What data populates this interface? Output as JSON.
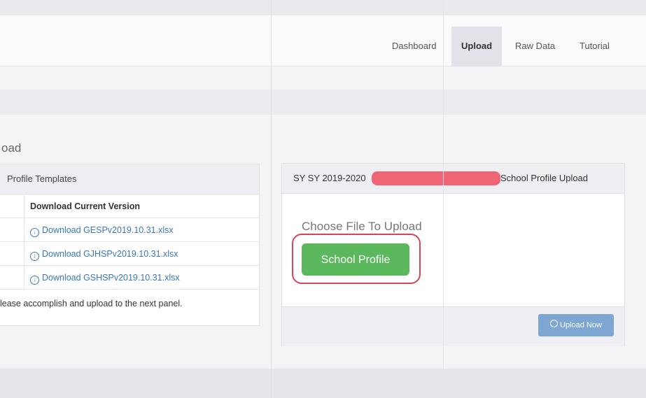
{
  "nav": {
    "items": [
      {
        "label": "Dashboard"
      },
      {
        "label": "Upload",
        "active": true
      },
      {
        "label": "Raw Data"
      },
      {
        "label": "Tutorial"
      }
    ]
  },
  "page": {
    "title": "oad"
  },
  "templates_panel": {
    "title": "Profile Templates",
    "column_header": "Download Current Version",
    "links": [
      "Download GESPv2019.10.31.xlsx",
      "Download GJHSPv2019.10.31.xlsx",
      "Download GSHSPv2019.10.31.xlsx"
    ],
    "note": "lease accomplish and upload to the next panel."
  },
  "upload_panel": {
    "sy_label": "SY SY 2019-2020",
    "title": "School Profile Upload",
    "choose_label": "Choose File To Upload",
    "file_button": "School Profile",
    "upload_button": "Upload Now"
  },
  "colors": {
    "accent_green": "#5cb85c",
    "link_blue": "#3a78b8",
    "highlight_red": "#d9445a",
    "redaction": "#ef6575",
    "upload_button": "#7ea6d3"
  }
}
